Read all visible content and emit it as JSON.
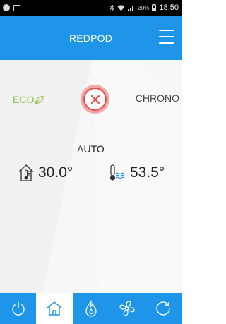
{
  "status_bar": {
    "signal_small": "30%",
    "time": "18:50"
  },
  "header": {
    "title": "REDPOD",
    "menu_icon": "hamburger-menu-icon"
  },
  "modes": {
    "eco_label": "ECO",
    "chrono_label": "CHRONO",
    "off_icon": "close-icon",
    "current_mode": "AUTO"
  },
  "temperatures": {
    "room": "30.0°",
    "water": "53.5°"
  },
  "bottom_nav": {
    "items": [
      {
        "name": "power-icon",
        "active": false
      },
      {
        "name": "home-icon",
        "active": true
      },
      {
        "name": "flame-icon",
        "active": false
      },
      {
        "name": "fan-icon",
        "active": false
      },
      {
        "name": "history-icon",
        "active": false
      }
    ]
  },
  "colors": {
    "primary": "#1e95e8",
    "eco": "#8cc152",
    "off": "#e84d4d"
  }
}
